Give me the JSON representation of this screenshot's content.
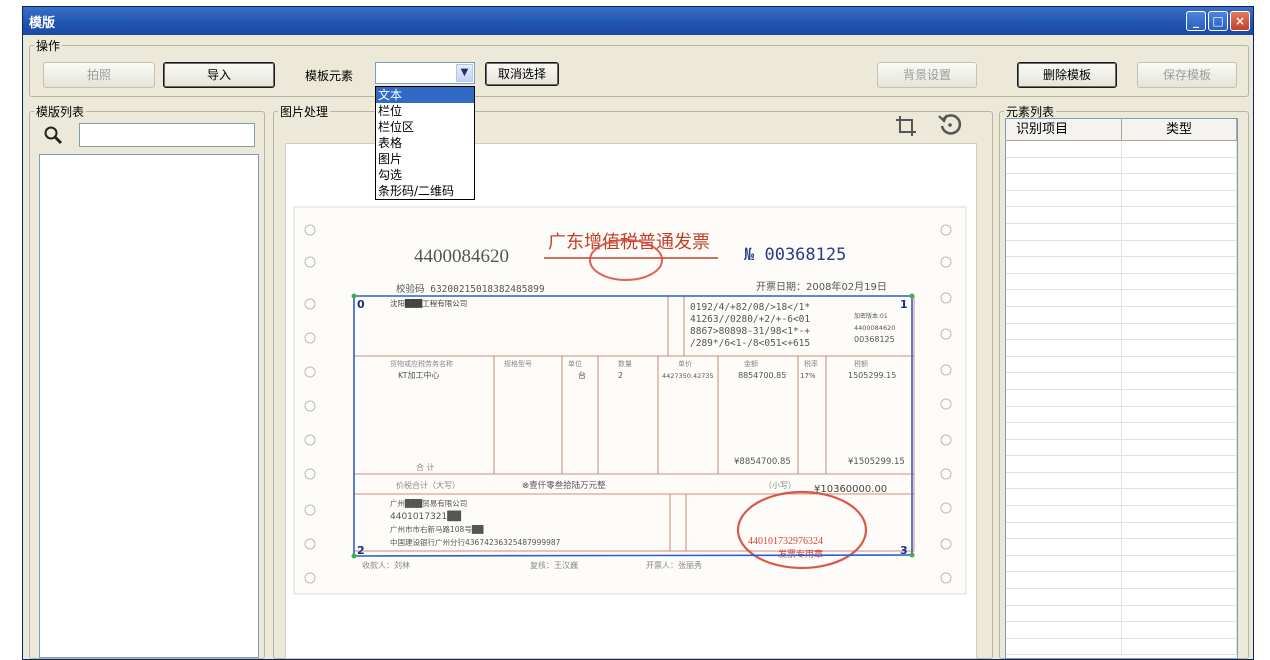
{
  "window": {
    "title": "模版",
    "controls": [
      "_",
      "□",
      "×"
    ]
  },
  "ops": {
    "legend": "操作",
    "capture_label": "拍照",
    "import_label": "导入",
    "element_label": "模板元素",
    "element_value": "",
    "cancel_label": "取消选择",
    "bg_label": "背景设置",
    "delete_label": "删除模板",
    "save_label": "保存模板"
  },
  "dropdown": {
    "options": [
      "文本",
      "栏位",
      "栏位区",
      "表格",
      "图片",
      "勾选",
      "条形码/二维码"
    ],
    "selected_index": 0
  },
  "template_list": {
    "legend": "模版列表",
    "search_placeholder": ""
  },
  "image_panel": {
    "legend": "图片处理"
  },
  "element_list": {
    "legend": "元素列表",
    "columns": [
      "识别项目",
      "类型"
    ],
    "rows": []
  },
  "invoice": {
    "code": "4400084620",
    "title": "广东增值税普通发票",
    "number": "№ 00368125",
    "check_code": "校验码 63200215018382485899",
    "date": "开票日期：2008年02月19日",
    "buyer_name": "沈阳███工程有限公司",
    "cipher": [
      "0192/4/+82/08/>18</1*",
      "41263//0280/+2/+-6<01",
      "8867>80898-31/98<1*-+",
      "/289*/6<1-/8<051<+615"
    ],
    "side_code": "4400084620",
    "side_no": "00368125",
    "side_label": "加密版本:01",
    "item_header": [
      "货物或应税劳务名称",
      "规格型号",
      "单位",
      "数量",
      "单价",
      "金额",
      "税率",
      "税额"
    ],
    "item": [
      "KT加工中心",
      "",
      "台",
      "2",
      "4427350.42735",
      "8854700.85",
      "17%",
      "1505299.15"
    ],
    "total_label": "合  计",
    "total_amount": "¥8854700.85",
    "total_tax": "¥1505299.15",
    "grand_label": "价税合计（大写）",
    "grand_words": "⊗壹仟零叁拾陆万元整",
    "grand_small_label": "（小写）",
    "grand_small": "¥10360000.00",
    "seller_name": "广州███贸易有限公司",
    "seller_tax": "4401017321██",
    "seller_addr": "广州市市右新马路108号██",
    "seller_bank": "中国建设银行广州分行43674236325487999987",
    "stamp_text": "440101732976324",
    "stamp_sub": "发票专用章",
    "payee": "收款人：刘林",
    "reviewer": "复核：王汉巍",
    "drawer": "开票人：张丽秀",
    "corners": [
      "0",
      "1",
      "2",
      "3"
    ]
  }
}
